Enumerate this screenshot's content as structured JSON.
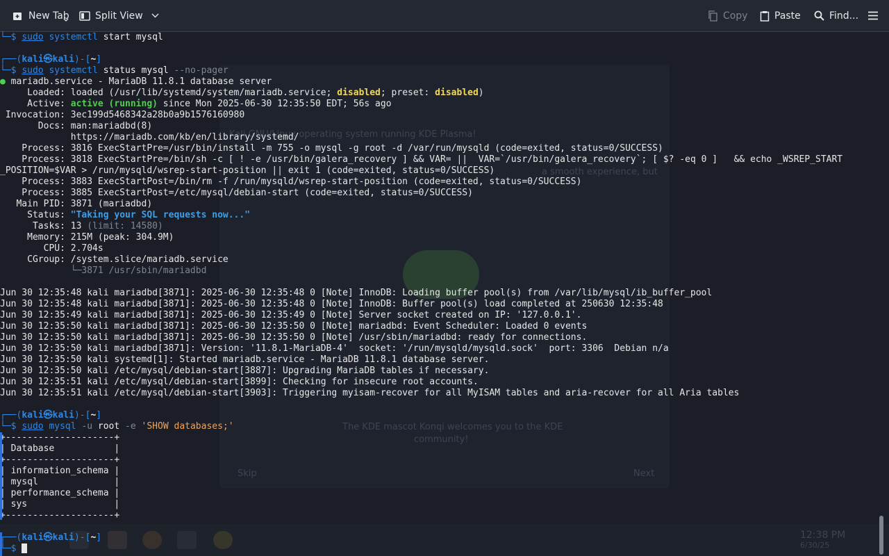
{
  "toolbar": {
    "new_tab": "New Tab",
    "split_view": "Split View",
    "copy": "Copy",
    "paste": "Paste",
    "find": "Find..."
  },
  "background": {
    "welcome_line1": "Kali GNU/Linux operating system running KDE Plasma!",
    "welcome_line2": "a smooth experience, but",
    "welcome_line3": "The KDE mascot Konqi welcomes you to the KDE",
    "welcome_line4": "community!",
    "skip": "Skip",
    "next": "Next",
    "clock_time": "12:38 PM",
    "clock_date": "6/30/25"
  },
  "prompt": {
    "user": "kali",
    "at": "㉿",
    "host": "kali",
    "dir": "~"
  },
  "commands": {
    "start": {
      "sudo": "sudo",
      "cmd": "systemctl",
      "args": " start mysql"
    },
    "status": {
      "sudo": "sudo",
      "cmd": "systemctl",
      "args": " status mysql",
      "flag": " --no-pager"
    },
    "show": {
      "sudo": "sudo",
      "cmd": "mysql",
      "flag": " -u",
      "args": " root",
      "flag2": " -e",
      "str": " 'SHOW databases;'"
    }
  },
  "status": {
    "head": " mariadb.service - MariaDB 11.8.1 database server",
    "loaded_pre": "     Loaded: loaded (/usr/lib/systemd/system/mariadb.service; ",
    "disabled": "disabled",
    "loaded_mid": "; preset: ",
    "loaded_post": ")",
    "active_pre": "     Active: ",
    "active": "active (running)",
    "active_post": " since Mon 2025-06-30 12:35:50 EDT; 56s ago",
    "invocation": " Invocation: 3ec199d5468342a28b0a9b1576160980",
    "docs1": "       Docs: man:mariadbd(8)",
    "docs2": "             https://mariadb.com/kb/en/library/systemd/",
    "process1": "    Process: 3816 ExecStartPre=/usr/bin/install -m 755 -o mysql -g root -d /var/run/mysqld (code=exited, status=0/SUCCESS)",
    "process2": "    Process: 3818 ExecStartPre=/bin/sh -c [ ! -e /usr/bin/galera_recovery ] && VAR= ||  VAR=`/usr/bin/galera_recovery`; [ $? -eq 0 ]   && echo _WSREP_START",
    "process2b": "_POSITION=$VAR > /run/mysqld/wsrep-start-position || exit 1 (code=exited, status=0/SUCCESS)",
    "process3": "    Process: 3883 ExecStartPost=/bin/rm -f /run/mysqld/wsrep-start-position (code=exited, status=0/SUCCESS)",
    "process4": "    Process: 3885 ExecStartPost=/etc/mysql/debian-start (code=exited, status=0/SUCCESS)",
    "mainpid": "   Main PID: 3871 (mariadbd)",
    "status_pre": "     Status: ",
    "status_val": "\"Taking your SQL requests now...\"",
    "tasks_pre": "      Tasks: 13",
    "tasks_limit": " (limit: 14580)",
    "memory": "     Memory: 215M (peak: 304.9M)",
    "cpu": "        CPU: 2.704s",
    "cgroup": "     CGroup: /system.slice/mariadb.service",
    "cgroup_child": "             └─3871 /usr/sbin/mariadbd"
  },
  "journal": [
    "Jun 30 12:35:48 kali mariadbd[3871]: 2025-06-30 12:35:48 0 [Note] InnoDB: Loading buffer pool(s) from /var/lib/mysql/ib_buffer_pool",
    "Jun 30 12:35:48 kali mariadbd[3871]: 2025-06-30 12:35:48 0 [Note] InnoDB: Buffer pool(s) load completed at 250630 12:35:48",
    "Jun 30 12:35:49 kali mariadbd[3871]: 2025-06-30 12:35:49 0 [Note] Server socket created on IP: '127.0.0.1'.",
    "Jun 30 12:35:50 kali mariadbd[3871]: 2025-06-30 12:35:50 0 [Note] mariadbd: Event Scheduler: Loaded 0 events",
    "Jun 30 12:35:50 kali mariadbd[3871]: 2025-06-30 12:35:50 0 [Note] /usr/sbin/mariadbd: ready for connections.",
    "Jun 30 12:35:50 kali mariadbd[3871]: Version: '11.8.1-MariaDB-4'  socket: '/run/mysqld/mysqld.sock'  port: 3306  Debian n/a",
    "Jun 30 12:35:50 kali systemd[1]: Started mariadb.service - MariaDB 11.8.1 database server.",
    "Jun 30 12:35:50 kali /etc/mysql/debian-start[3887]: Upgrading MariaDB tables if necessary.",
    "Jun 30 12:35:51 kali /etc/mysql/debian-start[3899]: Checking for insecure root accounts.",
    "Jun 30 12:35:51 kali /etc/mysql/debian-start[3903]: Triggering myisam-recover for all MyISAM tables and aria-recover for all Aria tables"
  ],
  "db_table": [
    "+--------------------+",
    "| Database           |",
    "+--------------------+",
    "| information_schema |",
    "| mysql              |",
    "| performance_schema |",
    "| sys                |",
    "+--------------------+"
  ]
}
